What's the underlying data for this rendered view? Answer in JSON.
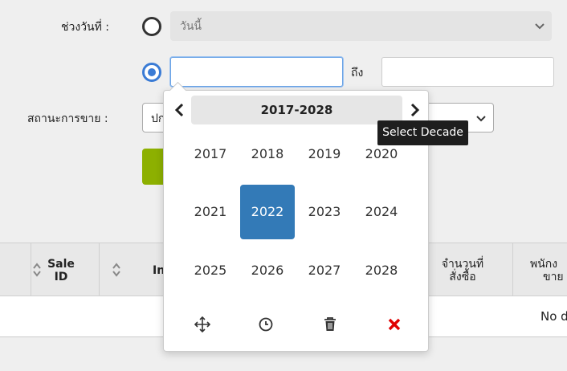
{
  "filter": {
    "date_range_label": "ช่วงวันที่ :",
    "preset_value": "วันนี้",
    "to_label": "ถึง",
    "status_label": "สถานะการขาย :",
    "status_value": "ปก"
  },
  "table": {
    "headers": [
      "Sale ID",
      "In",
      "จำนวนที่สั่งซื้อ",
      "พนักงาน ขาย"
    ],
    "sale_id_line1": "Sale",
    "sale_id_line2": "ID",
    "qty_line1": "จำนวนที่",
    "qty_line2": "สั่งซื้อ",
    "staff_line1": "พนักง",
    "staff_line2": "ขาย",
    "no_data": "No d"
  },
  "picker": {
    "range": "2017-2028",
    "years": [
      "2017",
      "2018",
      "2019",
      "2020",
      "2021",
      "2022",
      "2023",
      "2024",
      "2025",
      "2026",
      "2027",
      "2028"
    ],
    "selected_year": "2022",
    "tooltip": "Select Decade",
    "tools": [
      "move-icon",
      "clock-icon",
      "trash-icon",
      "close-icon"
    ]
  },
  "colors": {
    "accent": "#337ab7",
    "radio_active": "#3a7bd5",
    "green": "#8db000",
    "close_red": "#e00000"
  }
}
